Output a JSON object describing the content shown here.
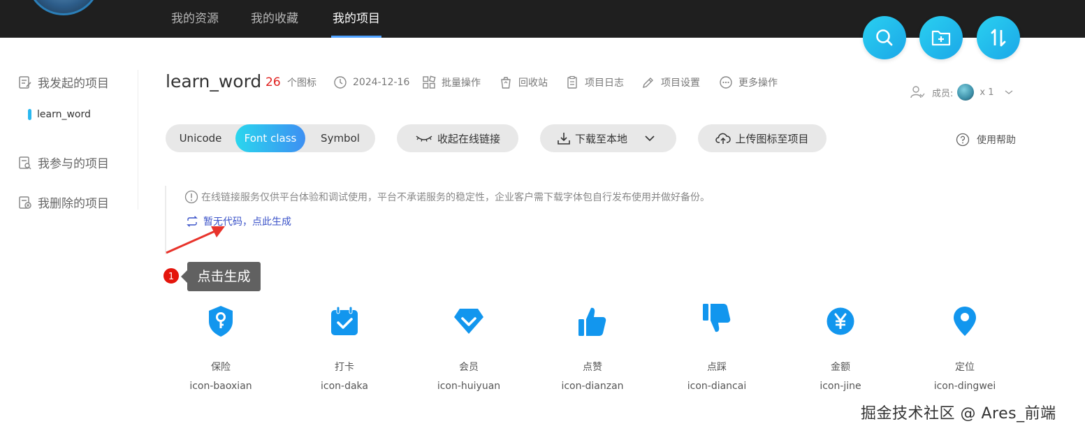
{
  "nav": {
    "tabs": [
      {
        "label": "我的资源"
      },
      {
        "label": "我的收藏"
      },
      {
        "label": "我的项目"
      }
    ]
  },
  "sidebar": {
    "created": "我发起的项目",
    "project": "learn_word",
    "joined": "我参与的项目",
    "deleted": "我删除的项目"
  },
  "header": {
    "title": "learn_word",
    "count": "26",
    "count_unit": "个图标",
    "date": "2024-12-16",
    "batch": "批量操作",
    "recycle": "回收站",
    "log": "项目日志",
    "settings": "项目设置",
    "more": "更多操作",
    "member_label": "成员:",
    "member_count": "x 1"
  },
  "toolbar": {
    "formats": [
      "Unicode",
      "Font class",
      "Symbol"
    ],
    "active_format": "Font class",
    "collapse": "收起在线链接",
    "download": "下载至本地",
    "upload": "上传图标至项目",
    "help": "使用帮助"
  },
  "notice": {
    "text": "在线链接服务仅供平台体验和调试使用，平台不承诺服务的稳定性，企业客户需下载字体包自行发布使用并做好备份。",
    "generate": "暂无代码，点此生成"
  },
  "annotation": {
    "step": "1",
    "tooltip": "点击生成"
  },
  "icons": [
    {
      "name": "保险",
      "code": "icon-baoxian",
      "icon": "shield-key-icon"
    },
    {
      "name": "打卡",
      "code": "icon-daka",
      "icon": "calendar-check-icon"
    },
    {
      "name": "会员",
      "code": "icon-huiyuan",
      "icon": "diamond-icon"
    },
    {
      "name": "点赞",
      "code": "icon-dianzan",
      "icon": "thumbs-up-icon"
    },
    {
      "name": "点踩",
      "code": "icon-diancai",
      "icon": "thumbs-down-icon"
    },
    {
      "name": "金额",
      "code": "icon-jine",
      "icon": "yen-icon"
    },
    {
      "name": "定位",
      "code": "icon-dingwei",
      "icon": "location-pin-icon"
    }
  ],
  "colors": {
    "accent": "#1296ee",
    "fab": "#22bfee",
    "count": "#e0201e",
    "link": "#3a52c8"
  },
  "watermark": "掘金技术社区 @ Ares_前端"
}
